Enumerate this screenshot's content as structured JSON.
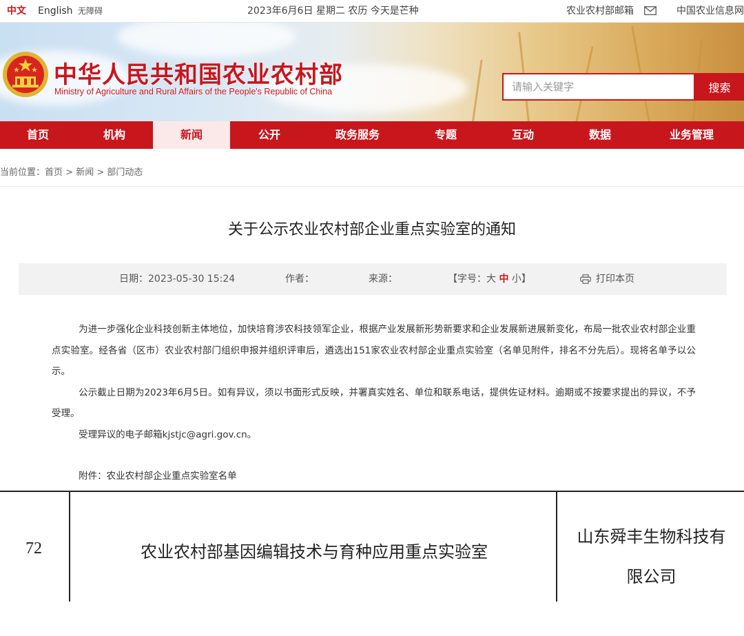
{
  "topbar": {
    "lang_cn": "中文",
    "lang_en": "English",
    "accessibility": "无障碍",
    "date_line": "2023年6月6日 星期二 农历 今天是芒种",
    "mailbox": "农业农村部邮箱",
    "info_network": "中国农业信息网"
  },
  "header": {
    "title": "中华人民共和国农业农村部",
    "subtitle": "Ministry of Agriculture and Rural Affairs of the People's Republic of China",
    "search_placeholder": "请输入关键字",
    "search_button": "搜索"
  },
  "nav": {
    "items": [
      {
        "label": "首页"
      },
      {
        "label": "机构"
      },
      {
        "label": "新闻"
      },
      {
        "label": "公开"
      },
      {
        "label": "政务服务"
      },
      {
        "label": "专题"
      },
      {
        "label": "互动"
      },
      {
        "label": "数据"
      },
      {
        "label": "业务管理"
      }
    ],
    "active": "新闻"
  },
  "breadcrumb": {
    "prefix": "当前位置：",
    "items": [
      "首页",
      "新闻",
      "部门动态"
    ],
    "separator": " > "
  },
  "article": {
    "title": "关于公示农业农村部企业重点实验室的通知",
    "date_label": "日期：",
    "date": "2023-05-30 15:24",
    "author_label": "作者：",
    "source_label": "来源：",
    "font_size_label": "【字号：",
    "font_large": "大",
    "font_medium": "中",
    "font_small": "小",
    "font_close": "】",
    "print_label": "打印本页",
    "paragraphs": [
      "为进一步强化企业科技创新主体地位，加快培育涉农科技领军企业，根据产业发展新形势新要求和企业发展新进展新变化，布局一批农业农村部企业重点实验室。经各省（区市）农业农村部门组织申报并组织评审后，遴选出151家农业农村部企业重点实验室（名单见附件，排名不分先后）。现将名单予以公示。",
      "公示截止日期为2023年6月5日。如有异议，须以书面形式反映，并署真实姓名、单位和联系电话，提供佐证材料。逾期或不按要求提出的异议，不予受理。",
      "受理异议的电子邮箱kjstjc@agri.gov.cn。"
    ],
    "attachment": "附件：农业农村部企业重点实验室名单"
  },
  "list_table": {
    "rows": [
      {
        "number": "72",
        "lab": "农业农村部基因编辑技术与育种应用重点实验室",
        "company_line1": "山东舜丰生物科技有",
        "company_line2": "限公司"
      }
    ]
  },
  "colors": {
    "brand_red": "#c8161d",
    "nav_active_bg": "#fbe9e9",
    "infobar_bg": "#f2f2f2"
  },
  "icons": {
    "mail": "mail-icon",
    "print": "printer-icon",
    "emblem": "national-emblem-icon"
  }
}
